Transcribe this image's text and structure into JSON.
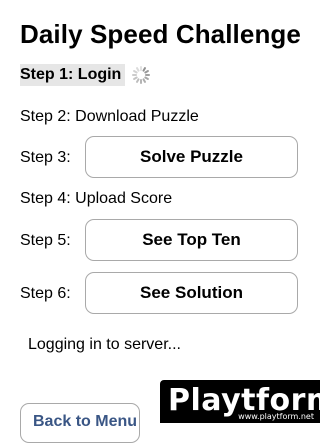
{
  "header": {
    "title": "Daily Speed Challenge"
  },
  "steps": {
    "step1": {
      "label": "Step 1: Login",
      "active": true,
      "spinner_icon": "loading-spinner-icon"
    },
    "step2": {
      "label": "Step 2: Download Puzzle"
    },
    "step3": {
      "label": "Step 3:",
      "button_label": "Solve Puzzle"
    },
    "step4": {
      "label": "Step 4: Upload Score"
    },
    "step5": {
      "label": "Step 5:",
      "button_label": "See Top Ten"
    },
    "step6": {
      "label": "Step 6:",
      "button_label": "See Solution"
    }
  },
  "status": {
    "message": "Logging in to server..."
  },
  "footer": {
    "back_label": "Back to Menu"
  },
  "watermark": {
    "logo_text": "Playtform",
    "url": "www.playtform.net"
  },
  "colors": {
    "active_step_bg": "#e6e6e6",
    "back_button_text": "#3a5685",
    "button_border": "#a9a9a9"
  }
}
